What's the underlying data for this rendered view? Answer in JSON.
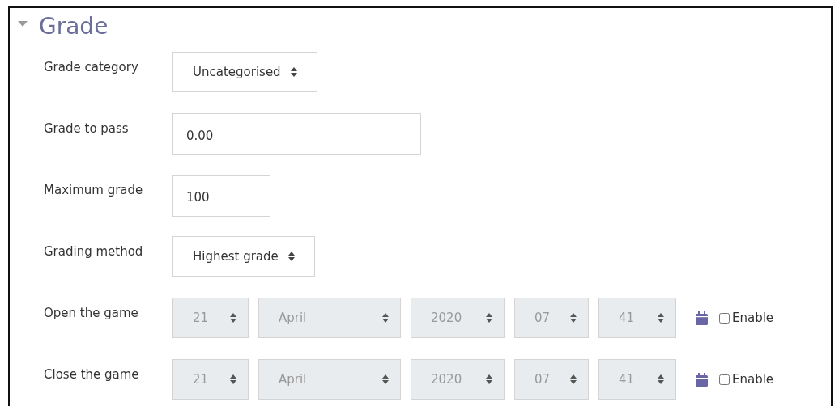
{
  "section": {
    "title": "Grade",
    "expanded": true
  },
  "fields": [
    {
      "kind": "select",
      "label": "Grade category",
      "value": "Uncategorised"
    },
    {
      "kind": "text",
      "label": "Grade to pass",
      "value": "0.00"
    },
    {
      "kind": "number",
      "label": "Maximum grade",
      "value": "100"
    },
    {
      "kind": "select",
      "label": "Grading method",
      "value": "Highest grade"
    },
    {
      "kind": "date",
      "label": "Open the game",
      "disabled": true,
      "parts": [
        "21",
        "April",
        "2020",
        "07",
        "41"
      ],
      "enable": {
        "label": "Enable",
        "checked": false
      }
    },
    {
      "kind": "date",
      "label": "Close the game",
      "disabled": true,
      "parts": [
        "21",
        "April",
        "2020",
        "07",
        "41"
      ],
      "enable": {
        "label": "Enable",
        "checked": false
      }
    }
  ]
}
